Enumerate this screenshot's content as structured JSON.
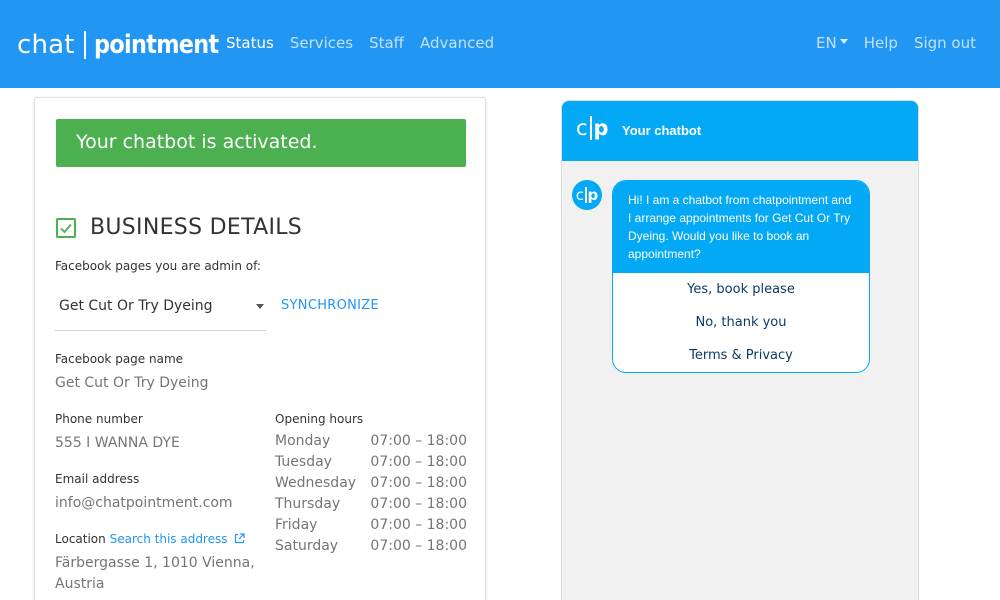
{
  "navbar": {
    "brand_left": "chat",
    "brand_right": "pointment",
    "links": [
      "Status",
      "Services",
      "Staff",
      "Advanced"
    ],
    "language": "EN",
    "help": "Help",
    "signout": "Sign out",
    "color": "#2196f3"
  },
  "alert": {
    "text": "Your chatbot is activated.",
    "color": "#4caf50"
  },
  "business": {
    "title": "BUSINESS DETAILS",
    "fb_pages_label": "Facebook pages you are admin of:",
    "fb_selected": "Get Cut Or Try Dyeing",
    "sync_label": "SYNCHRONIZE",
    "fb_name_label": "Facebook page name",
    "fb_name_value": "Get Cut Or Try Dyeing",
    "phone_label": "Phone number",
    "phone_value": "555 I WANNA DYE",
    "email_label": "Email address",
    "email_value": "info@chatpointment.com",
    "location_label": "Location",
    "location_link": "Search this address",
    "location_line1": "Färbergasse 1, 1010 Vienna,",
    "location_line2": "Austria",
    "hours_label": "Opening hours",
    "hours": [
      {
        "day": "Monday",
        "time": "07:00 – 18:00"
      },
      {
        "day": "Tuesday",
        "time": "07:00 – 18:00"
      },
      {
        "day": "Wednesday",
        "time": "07:00 – 18:00"
      },
      {
        "day": "Thursday",
        "time": "07:00 – 18:00"
      },
      {
        "day": "Friday",
        "time": "07:00 – 18:00"
      },
      {
        "day": "Saturday",
        "time": "07:00 – 18:00"
      }
    ]
  },
  "chatbot": {
    "logo_c": "c",
    "logo_p": "p",
    "title": "Your chatbot",
    "message": "Hi! I am a chatbot from chatpointment and I arrange appointments for Get Cut Or Try Dyeing. Would you like to book an appointment?",
    "replies": [
      "Yes, book please",
      "No, thank you",
      "Terms & Privacy"
    ],
    "accent": "#03a9f4"
  }
}
